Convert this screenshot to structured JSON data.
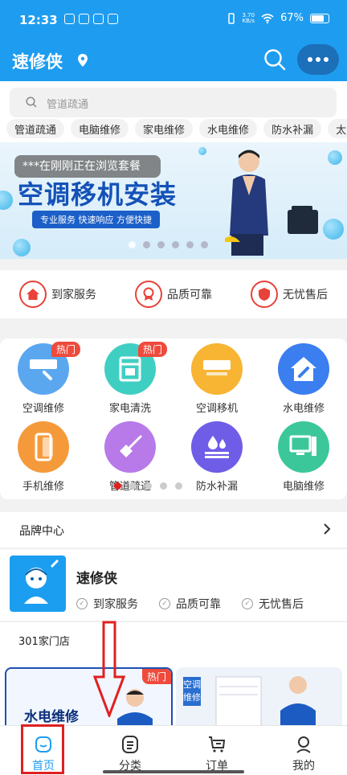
{
  "status_bar": {
    "time": "12:33",
    "net_speed_top": "3.70",
    "net_speed_bottom": "KB/s",
    "battery": "67%"
  },
  "header": {
    "title": "速修侠",
    "bg_color": "#1e9df0"
  },
  "search": {
    "placeholder": "管道疏通",
    "tags": [
      "管道疏通",
      "电脑维修",
      "家电维修",
      "水电维修",
      "防水补漏",
      "太"
    ]
  },
  "banner": {
    "toast": "***在刚刚正在浏览套餐",
    "headline": "空调移机安装",
    "slogan": "专业服务  快速响应  方便快捷",
    "slide_count": 6,
    "active_slide": 0
  },
  "features": [
    {
      "label": "到家服务",
      "icon": "home-icon"
    },
    {
      "label": "品质可靠",
      "icon": "medal-icon"
    },
    {
      "label": "无忧售后",
      "icon": "shield-icon"
    }
  ],
  "services": [
    {
      "label": "空调维修",
      "hot": "热门",
      "color": "#5aa7f0",
      "icon": "ac-repair-icon"
    },
    {
      "label": "家电清洗",
      "hot": "热门",
      "color": "#3fcfc2",
      "icon": "appliance-clean-icon"
    },
    {
      "label": "空调移机",
      "hot": "",
      "color": "#f8b533",
      "icon": "ac-move-icon"
    },
    {
      "label": "水电维修",
      "hot": "",
      "color": "#3a7ef0",
      "icon": "house-wrench-icon"
    },
    {
      "label": "手机维修",
      "hot": "",
      "color": "#f59a3a",
      "icon": "phone-icon"
    },
    {
      "label": "管道疏通",
      "hot": "",
      "color": "#b77ae8",
      "icon": "plunger-icon"
    },
    {
      "label": "防水补漏",
      "hot": "",
      "color": "#6f5de8",
      "icon": "waterproof-icon"
    },
    {
      "label": "电脑维修",
      "hot": "",
      "color": "#3cc79a",
      "icon": "computer-icon"
    }
  ],
  "grid_pager": {
    "count": 5,
    "active": 0
  },
  "brand_center": {
    "title": "品牌中心",
    "name": "速修侠",
    "badges": [
      "到家服务",
      "品质可靠",
      "无忧售后"
    ]
  },
  "store": {
    "title": "301家门店"
  },
  "cards": {
    "card1_title": "水电维修",
    "card1_hot": "热门",
    "card2_vertical": "空调维修"
  },
  "tabbar": [
    {
      "label": "首页",
      "icon": "home-tab-icon",
      "active": true
    },
    {
      "label": "分类",
      "icon": "category-icon",
      "active": false
    },
    {
      "label": "订单",
      "icon": "cart-icon",
      "active": false
    },
    {
      "label": "我的",
      "icon": "user-icon",
      "active": false
    }
  ],
  "annotation_color": "#e02020"
}
